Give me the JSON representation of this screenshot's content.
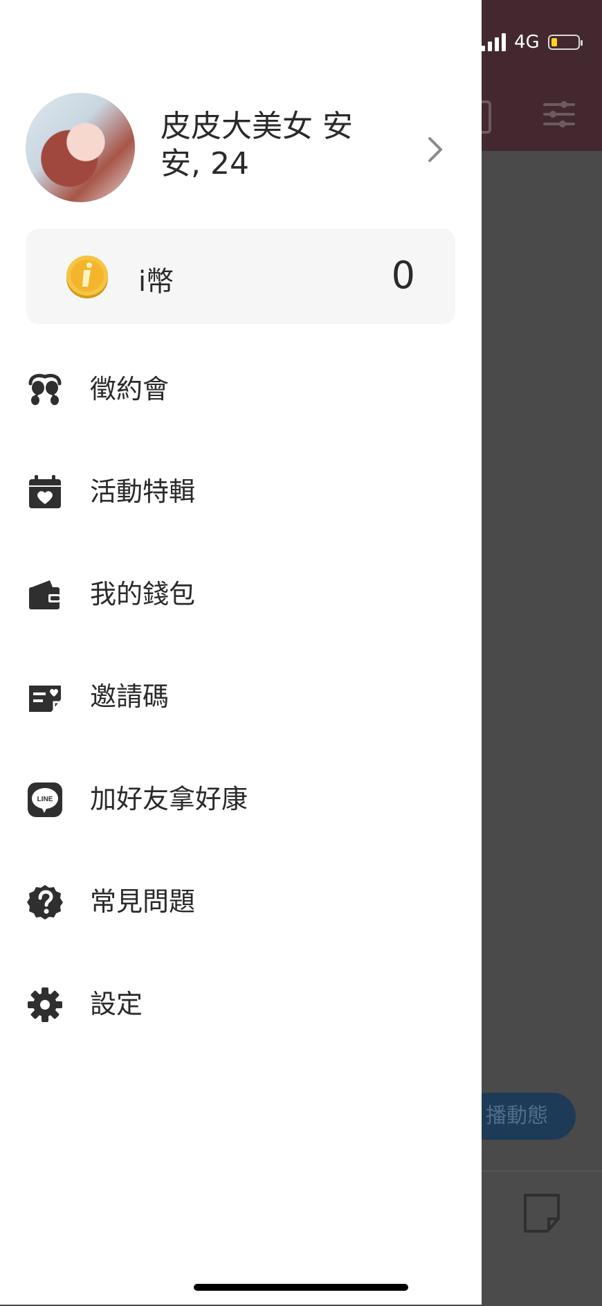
{
  "status_bar": {
    "network": "4G"
  },
  "background_app": {
    "broadcast_button_label": "播動態",
    "colors": {
      "header": "#43292f",
      "overlay": "#4a4a4a",
      "button": "#1d3a56"
    }
  },
  "drawer": {
    "profile": {
      "name": "皮皮大美女 安安, 24"
    },
    "coins": {
      "label": "i幣",
      "value": "0"
    },
    "menu": [
      {
        "label": "徵約會",
        "icon": "balloons-icon"
      },
      {
        "label": "活動特輯",
        "icon": "calendar-heart-icon"
      },
      {
        "label": "我的錢包",
        "icon": "wallet-icon"
      },
      {
        "label": "邀請碼",
        "icon": "invite-card-icon"
      },
      {
        "label": "加好友拿好康",
        "icon": "line-icon"
      },
      {
        "label": "常見問題",
        "icon": "help-icon"
      },
      {
        "label": "設定",
        "icon": "gear-icon"
      }
    ]
  }
}
